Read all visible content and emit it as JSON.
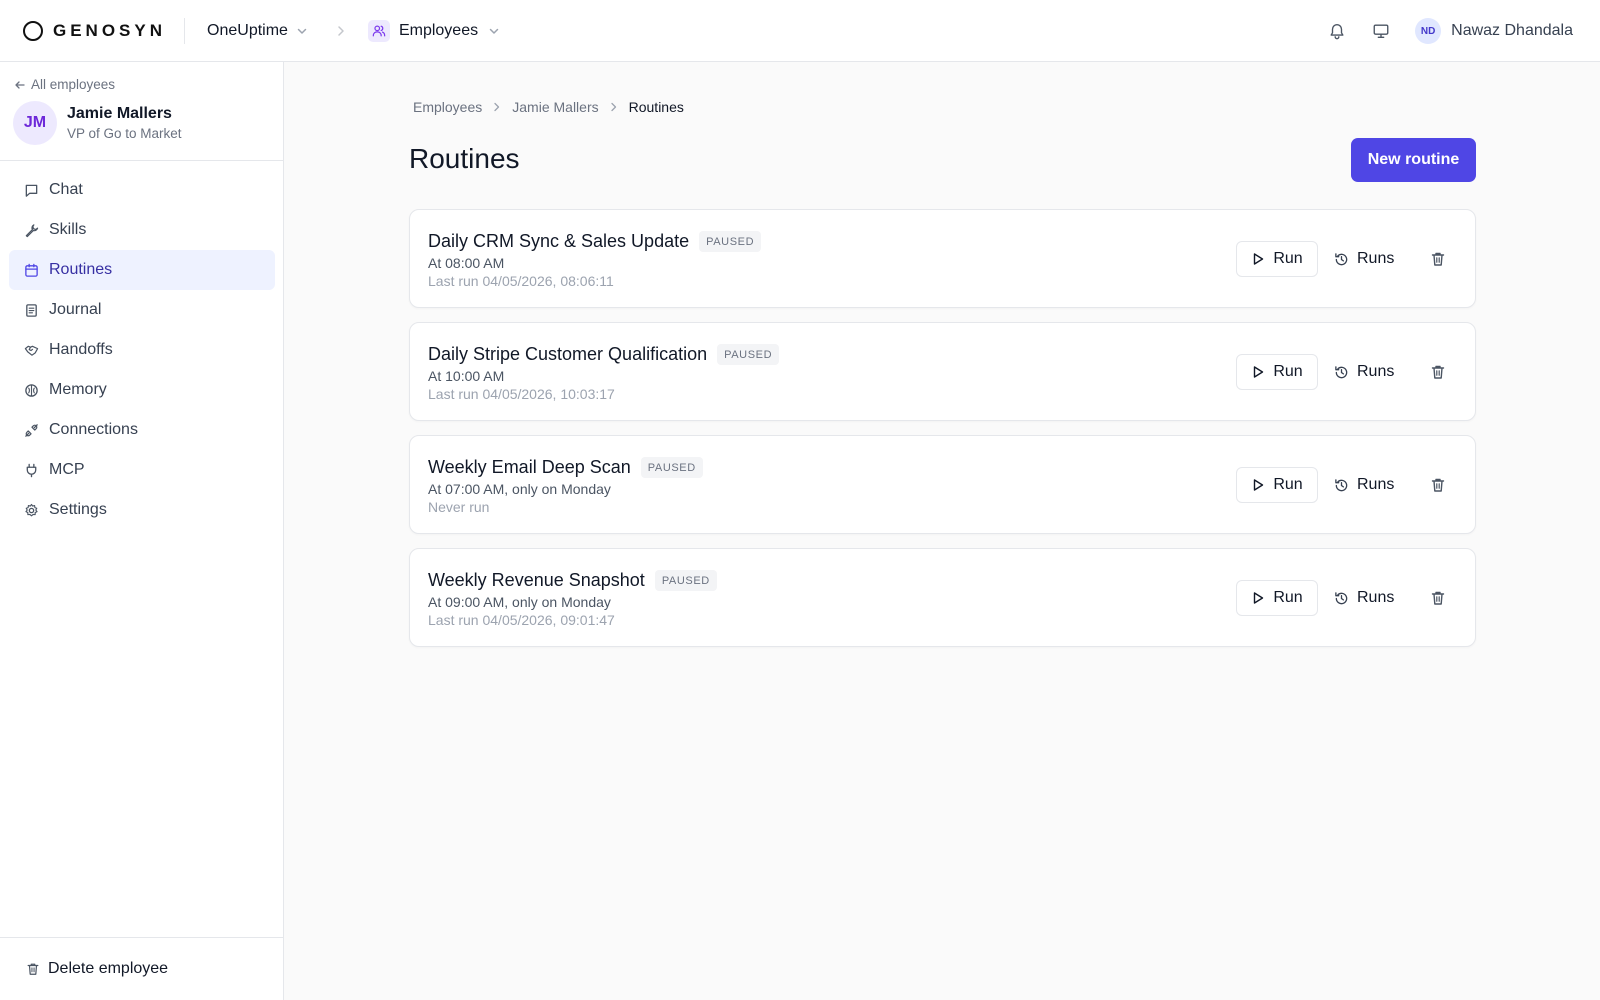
{
  "topbar": {
    "brand": "GENOSYN",
    "org": "OneUptime",
    "section": "Employees",
    "user_initials": "ND",
    "user_name": "Nawaz Dhandala"
  },
  "sidebar": {
    "back_label": "All employees",
    "employee": {
      "initials": "JM",
      "name": "Jamie Mallers",
      "role": "VP of Go to Market"
    },
    "nav": [
      {
        "label": "Chat",
        "icon": "chat-icon",
        "active": false
      },
      {
        "label": "Skills",
        "icon": "wrench-icon",
        "active": false
      },
      {
        "label": "Routines",
        "icon": "calendar-icon",
        "active": true
      },
      {
        "label": "Journal",
        "icon": "notebook-icon",
        "active": false
      },
      {
        "label": "Handoffs",
        "icon": "handshake-icon",
        "active": false
      },
      {
        "label": "Memory",
        "icon": "brain-icon",
        "active": false
      },
      {
        "label": "Connections",
        "icon": "plug-connection-icon",
        "active": false
      },
      {
        "label": "MCP",
        "icon": "plug-icon",
        "active": false
      },
      {
        "label": "Settings",
        "icon": "gear-icon",
        "active": false
      }
    ],
    "delete_label": "Delete employee"
  },
  "breadcrumb": [
    "Employees",
    "Jamie Mallers",
    "Routines"
  ],
  "page": {
    "title": "Routines",
    "new_button": "New routine"
  },
  "routines": [
    {
      "name": "Daily CRM Sync & Sales Update",
      "status": "PAUSED",
      "schedule": "At 08:00 AM",
      "last_run": "Last run 04/05/2026, 08:06:11"
    },
    {
      "name": "Daily Stripe Customer Qualification",
      "status": "PAUSED",
      "schedule": "At 10:00 AM",
      "last_run": "Last run 04/05/2026, 10:03:17"
    },
    {
      "name": "Weekly Email Deep Scan",
      "status": "PAUSED",
      "schedule": "At 07:00 AM, only on Monday",
      "last_run": "Never run"
    },
    {
      "name": "Weekly Revenue Snapshot",
      "status": "PAUSED",
      "schedule": "At 09:00 AM, only on Monday",
      "last_run": "Last run 04/05/2026, 09:01:47"
    }
  ],
  "actions": {
    "run_label": "Run",
    "runs_label": "Runs"
  },
  "colors": {
    "accent": "#4f46e5",
    "active_nav_bg": "#eef2ff",
    "badge_bg": "#f3f4f6"
  }
}
